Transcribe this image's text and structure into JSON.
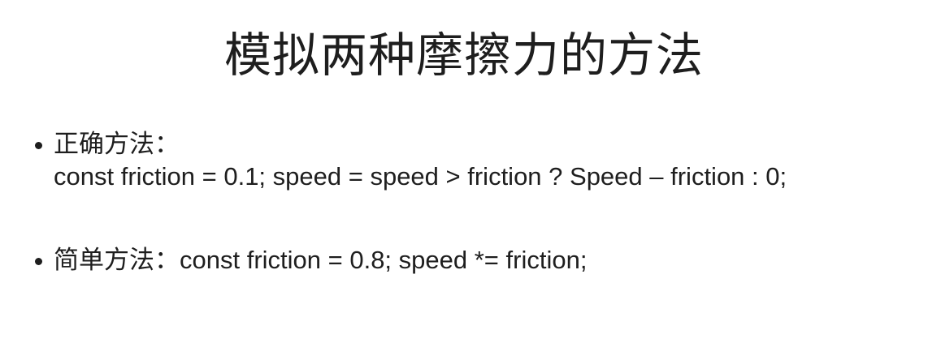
{
  "slide": {
    "title": "模拟两种摩擦力的方法",
    "bullets": [
      {
        "heading": "正确方法：",
        "code": "const friction = 0.1;  speed = speed > friction ? Speed – friction : 0;"
      },
      {
        "heading": "简单方法：",
        "code": "const friction = 0.8;  speed *= friction;"
      }
    ]
  }
}
